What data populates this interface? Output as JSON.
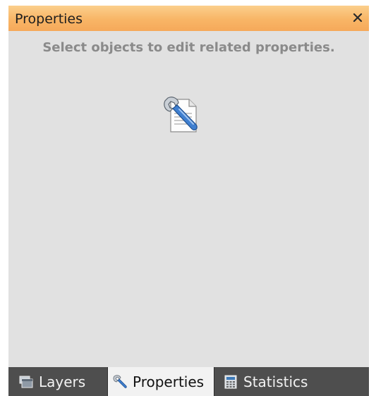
{
  "panel": {
    "title": "Properties",
    "close_glyph": "×",
    "hint": "Select objects to edit related properties.",
    "center_icon": "properties-icon"
  },
  "tabs": [
    {
      "label": "Layers",
      "icon": "layers-icon",
      "active": false
    },
    {
      "label": "Properties",
      "icon": "wrench-icon",
      "active": true
    },
    {
      "label": "Statistics",
      "icon": "calculator-icon",
      "active": false
    }
  ],
  "colors": {
    "title_bar": "#f8b566",
    "panel_bg": "#e1e1e1",
    "tab_bar": "#4e4e4e",
    "active_tab": "#f2f2f2",
    "hint_text": "#8a8a8a"
  }
}
